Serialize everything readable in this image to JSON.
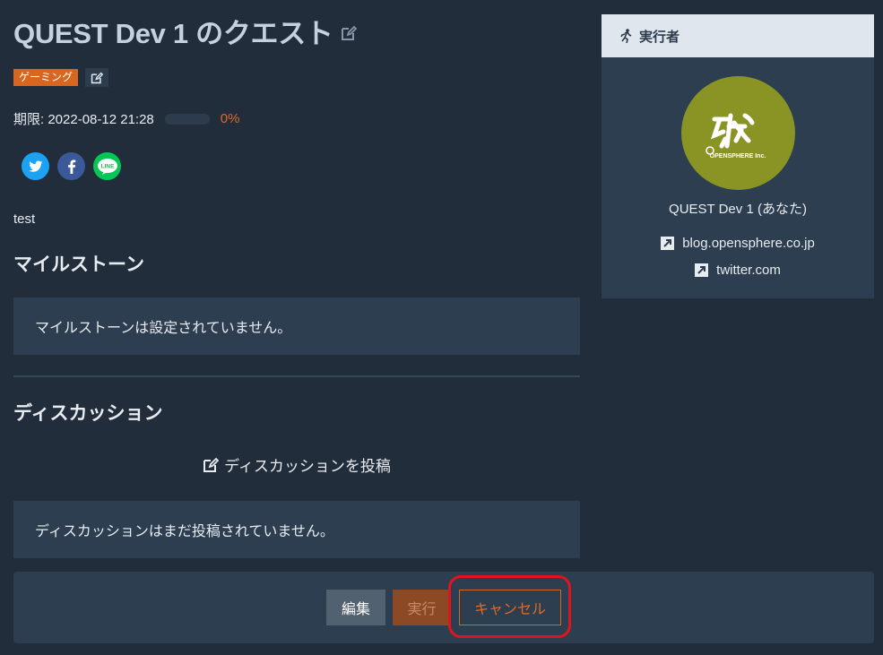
{
  "quest": {
    "title": "QUEST Dev 1 のクエスト",
    "tag": "ゲーミング",
    "due": "期限: 2022-08-12 21:28",
    "progress_percent": 0,
    "progress_label": "0%",
    "description": "test"
  },
  "share": {
    "icons": [
      "twitter-icon",
      "facebook-icon",
      "line-icon"
    ],
    "line_text": "LINE"
  },
  "milestone": {
    "heading": "マイルストーン",
    "empty_text": "マイルストーンは設定されていません。"
  },
  "discussion": {
    "heading": "ディスカッション",
    "post_label": "ディスカッションを投稿",
    "empty_text": "ディスカッションはまだ投稿されていません。"
  },
  "sidebar": {
    "heading": "実行者",
    "avatar_text": "OPENSPHERE Inc.",
    "user_name": "QUEST Dev 1 (あなた)",
    "links": [
      "blog.opensphere.co.jp",
      "twitter.com"
    ]
  },
  "footer": {
    "edit_label": "編集",
    "exec_label": "実行",
    "cancel_label": "キャンセル"
  },
  "colors": {
    "background": "#212d3b",
    "panel": "#2c3e50",
    "accent": "#d9661f",
    "highlight": "#e0141e"
  }
}
